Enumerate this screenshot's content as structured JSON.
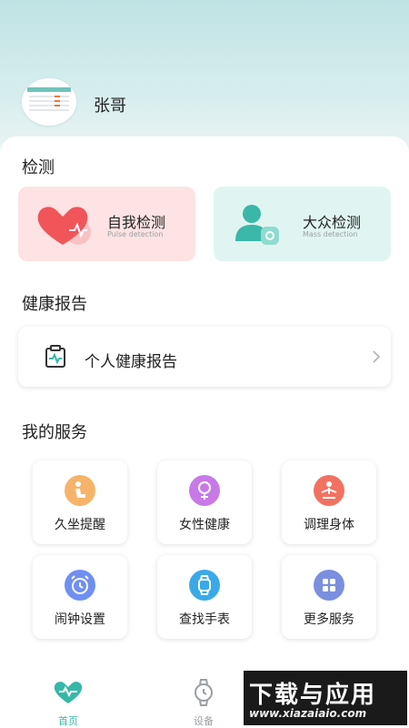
{
  "profile": {
    "name": "张哥"
  },
  "detection": {
    "title": "检测",
    "self": {
      "label": "自我检测",
      "sub": "Pulse detection"
    },
    "public": {
      "label": "大众检测",
      "sub": "Mass detection"
    }
  },
  "report": {
    "title": "健康报告",
    "item_label": "个人健康报告"
  },
  "services": {
    "title": "我的服务",
    "items": [
      {
        "label": "久坐提醒",
        "icon": "sitting-person-icon",
        "color": "#f6b46a"
      },
      {
        "label": "女性健康",
        "icon": "female-icon",
        "color": "#c779e6"
      },
      {
        "label": "调理身体",
        "icon": "meditation-icon",
        "color": "#f27262"
      },
      {
        "label": "闹钟设置",
        "icon": "alarm-clock-icon",
        "color": "#6f8ff2"
      },
      {
        "label": "查找手表",
        "icon": "watch-icon",
        "color": "#3aa9e8"
      },
      {
        "label": "更多服务",
        "icon": "grid-icon",
        "color": "#7a8fe0"
      }
    ]
  },
  "tabbar": {
    "home": "首页",
    "device": "设备"
  },
  "watermark": {
    "main": "下载与应用",
    "url": "www.xiazaiaio.com"
  },
  "colors": {
    "accent": "#35b8a8",
    "self_card": "#fde3e3",
    "public_card": "#e0f5f1"
  }
}
